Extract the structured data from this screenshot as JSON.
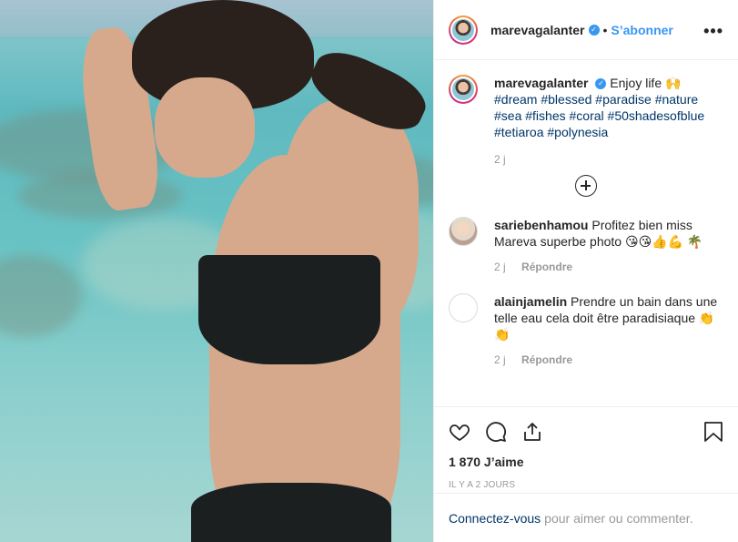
{
  "header": {
    "username": "marevagalanter",
    "follow_label": "S’abonner",
    "separator": "•",
    "more_label": "•••"
  },
  "caption": {
    "username": "marevagalanter",
    "text": "Enjoy life 🙌",
    "hashtags": [
      "#dream",
      "#blessed",
      "#paradise",
      "#nature",
      "#sea",
      "#fishes",
      "#coral",
      "#50shadesofblue",
      "#tetiaroa",
      "#polynesia"
    ],
    "time": "2 j"
  },
  "comments": [
    {
      "username": "sariebenhamou",
      "text": "Profitez bien miss Mareva superbe photo 😘😘👍💪 🌴",
      "time": "2 j",
      "reply_label": "Répondre"
    },
    {
      "username": "alainjamelin",
      "text": "Prendre un bain dans une telle eau cela doit être paradisiaque 👏👏",
      "time": "2 j",
      "reply_label": "Répondre"
    }
  ],
  "actions": {
    "likes": "1 870 J’aime",
    "ago": "IL Y A 2 JOURS"
  },
  "login": {
    "link": "Connectez-vous",
    "text": "pour aimer ou commenter."
  },
  "icons": {
    "verified": "verified-badge-icon",
    "load_more": "plus-circle-icon",
    "like": "heart-icon",
    "comment": "comment-icon",
    "share": "share-icon",
    "save": "bookmark-icon"
  },
  "colors": {
    "link_blue": "#3897f0",
    "hashtag": "#003569",
    "muted": "#999999"
  }
}
